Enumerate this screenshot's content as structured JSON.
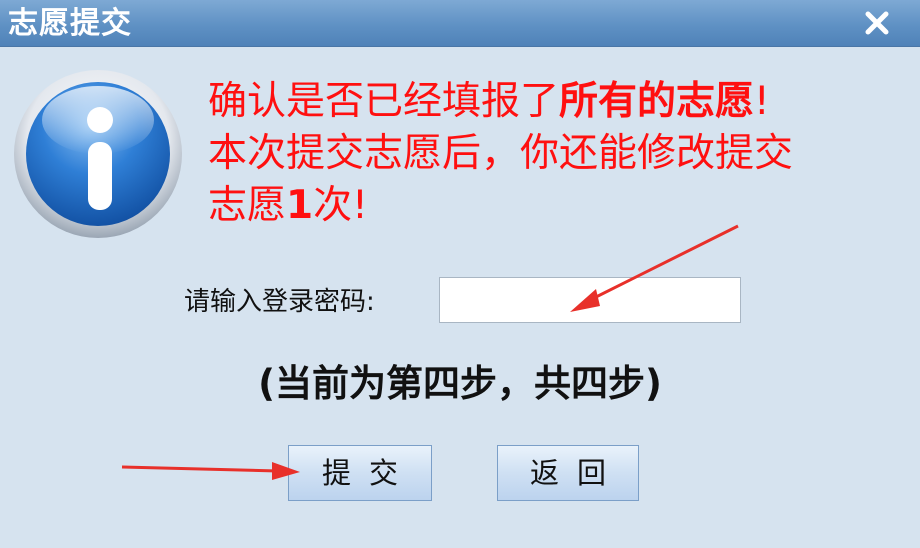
{
  "window": {
    "title": "志愿提交",
    "close_icon": "close-icon"
  },
  "message": {
    "part1": "确认是否已经填报了",
    "part1_bold": "所有的志愿",
    "part1_end": "!",
    "line2": "本次提交志愿后，你还能修改提交",
    "line3_start": "志愿",
    "line3_bold": "1",
    "line3_end": "次!"
  },
  "password": {
    "label": "请输入登录密码:",
    "value": "",
    "placeholder": ""
  },
  "step": {
    "text": "(当前为第四步，共四步)"
  },
  "buttons": {
    "submit_label": "提交",
    "back_label": "返回"
  },
  "colors": {
    "titlebar": "#5f91c4",
    "background": "#d6e3ef",
    "message_text": "#ff1010",
    "annotation_arrow": "#e8302a"
  },
  "icons": {
    "info": "info-icon"
  }
}
